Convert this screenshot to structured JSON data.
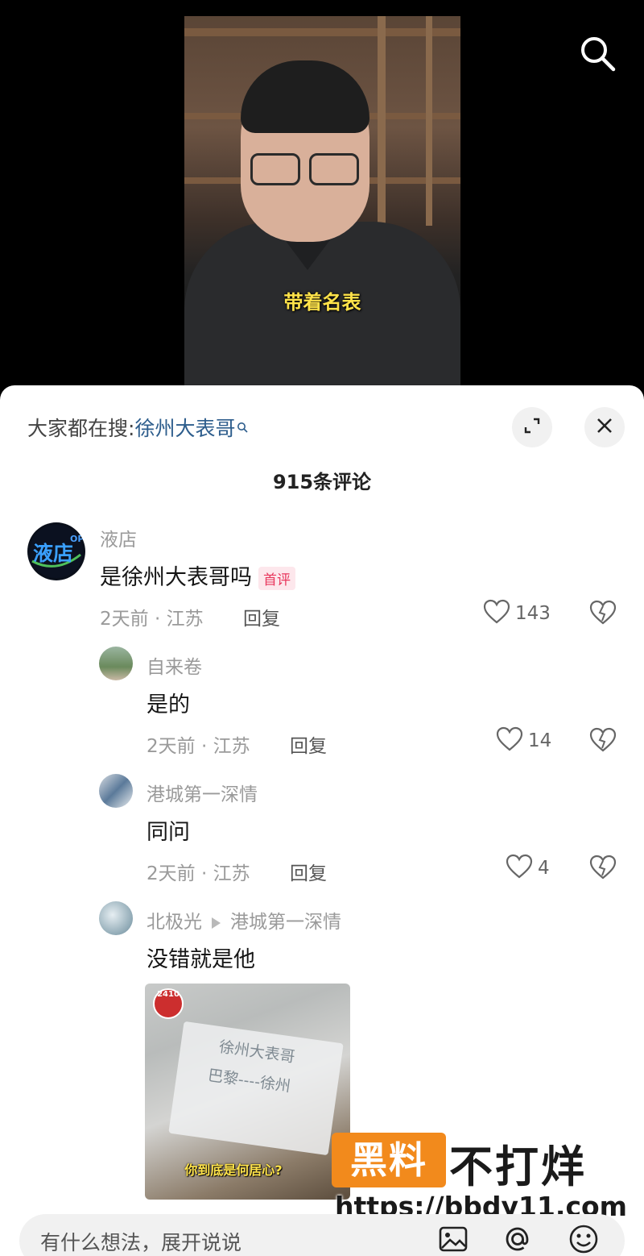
{
  "video": {
    "subtitle": "带着名表"
  },
  "search_icon": "search-icon",
  "header": {
    "search_prefix": "大家都在搜:",
    "search_keyword": "徐州大表哥",
    "expand_icon": "expand-icon",
    "close_icon": "close-icon"
  },
  "comment_count": "915条评论",
  "comments": [
    {
      "name": "液店",
      "text": "是徐州大表哥吗",
      "badge": "首评",
      "time": "2天前 · 江苏",
      "reply": "回复",
      "likes": "143"
    },
    {
      "name": "自来卷",
      "text": "是的",
      "time": "2天前 · 江苏",
      "reply": "回复",
      "likes": "14"
    },
    {
      "name": "港城第一深情",
      "text": "同问",
      "time": "2天前 · 江苏",
      "reply": "回复",
      "likes": "4"
    },
    {
      "name": "北极光",
      "reply_to": "港城第一深情",
      "text": "没错就是他",
      "image": {
        "count_badge": "2410",
        "line1": "徐州大表哥",
        "line2": "巴黎----徐州",
        "caption": "你到底是何居心?"
      }
    }
  ],
  "avatar_text": "液店",
  "avatar_small_text": "OPL",
  "watermark": {
    "box_text": "黑料",
    "main_text": "不打烊",
    "url": "https://bbdy11.com"
  },
  "input_bar": {
    "placeholder": "有什么想法，展开说说",
    "icons": [
      "image-icon",
      "at-icon",
      "emoji-icon"
    ]
  }
}
